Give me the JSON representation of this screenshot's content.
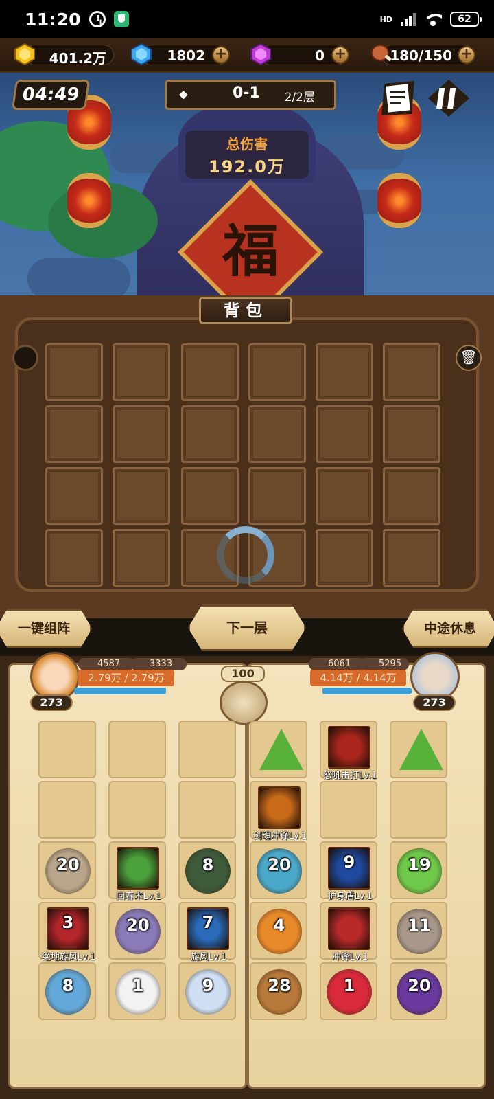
{
  "status": {
    "time": "11:20",
    "network": "HD",
    "battery": "62"
  },
  "resources": {
    "gold": "401.2万",
    "diamond": "1802",
    "crystal": "0",
    "stamina": "180/150",
    "plus": "+"
  },
  "scene": {
    "timer": "04:49",
    "stage": "0-1",
    "floor": "2/2层",
    "total_damage_label": "总伤害",
    "total_damage_value": "192.0万",
    "fu_char": "福"
  },
  "bag": {
    "title": "背包"
  },
  "actions": {
    "auto_formation": "一键组阵",
    "next_floor": "下一层",
    "midway_rest": "中途休息"
  },
  "hero_left": {
    "atk": "4587",
    "def": "3333",
    "hp": "2.79万 / 2.79万",
    "level": "273"
  },
  "hero_right": {
    "atk": "6061",
    "def": "5295",
    "hp": "4.14万 / 4.14万",
    "level": "273"
  },
  "center_value": "100",
  "left_grid": [
    {
      "kind": "empty"
    },
    {
      "kind": "empty"
    },
    {
      "kind": "empty"
    },
    {
      "kind": "empty"
    },
    {
      "kind": "empty"
    },
    {
      "kind": "empty"
    },
    {
      "kind": "unit",
      "num": "20",
      "color": "#b9a68a"
    },
    {
      "kind": "skill",
      "name": "回春术Lv.1",
      "color": "#4aa03a"
    },
    {
      "kind": "unit",
      "num": "8",
      "color": "#3d5a3a"
    },
    {
      "kind": "skill",
      "name": "绝地旋风Lv.1",
      "num": "3",
      "color": "#b3262a"
    },
    {
      "kind": "unit",
      "num": "20",
      "color": "#8a7ab8"
    },
    {
      "kind": "skill",
      "name": "旋风Lv.1",
      "num": "7",
      "color": "#2a6ab8"
    },
    {
      "kind": "unit",
      "num": "8",
      "color": "#62a8d8"
    },
    {
      "kind": "unit",
      "num": "1",
      "color": "#f2f2f2"
    },
    {
      "kind": "unit",
      "num": "9",
      "color": "#cfe0f4"
    }
  ],
  "right_grid": [
    {
      "kind": "crystal"
    },
    {
      "kind": "skill",
      "name": "怒吼击打Lv.1",
      "color": "#a8261c"
    },
    {
      "kind": "crystal"
    },
    {
      "kind": "skill",
      "name": "剑魂冲锋Lv.1",
      "color": "#c86a1a"
    },
    {
      "kind": "empty"
    },
    {
      "kind": "empty"
    },
    {
      "kind": "unit",
      "num": "20",
      "color": "#4aa8c8"
    },
    {
      "kind": "skill",
      "name": "护身盾Lv.1",
      "num": "9",
      "color": "#1f4aa0"
    },
    {
      "kind": "unit",
      "num": "19",
      "color": "#6ec84a"
    },
    {
      "kind": "unit",
      "num": "4",
      "color": "#e88a2a"
    },
    {
      "kind": "skill",
      "name": "冲锋Lv.1",
      "color": "#b82a2a"
    },
    {
      "kind": "unit",
      "num": "11",
      "color": "#a8988a"
    },
    {
      "kind": "unit",
      "num": "28",
      "color": "#b87a3a"
    },
    {
      "kind": "unit",
      "num": "1",
      "color": "#d82a3a"
    },
    {
      "kind": "unit",
      "num": "20",
      "color": "#6a3aa0"
    }
  ]
}
